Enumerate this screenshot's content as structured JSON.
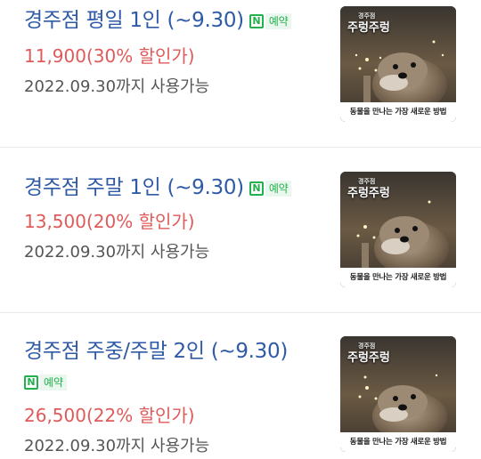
{
  "badge": {
    "icon": "naver-n-icon",
    "label": "예약",
    "color": "#22b14c"
  },
  "colors": {
    "title": "#2e5aa6",
    "price": "#e05a5a",
    "period": "#555555"
  },
  "thumbnail": {
    "logo_small": "경주점",
    "logo_main": "주렁주렁",
    "caption": "동물을 만나는 가장 새로운 방법"
  },
  "items": [
    {
      "title": "경주점 평일 1인 (~9.30)",
      "price": "11,900(30% 할인가)",
      "period": "2022.09.30까지 사용가능"
    },
    {
      "title": "경주점 주말 1인 (~9.30)",
      "price": "13,500(20% 할인가)",
      "period": "2022.09.30까지 사용가능"
    },
    {
      "title": "경주점 주중/주말 2인 (~9.30)",
      "price": "26,500(22% 할인가)",
      "period": "2022.09.30까지 사용가능"
    }
  ]
}
